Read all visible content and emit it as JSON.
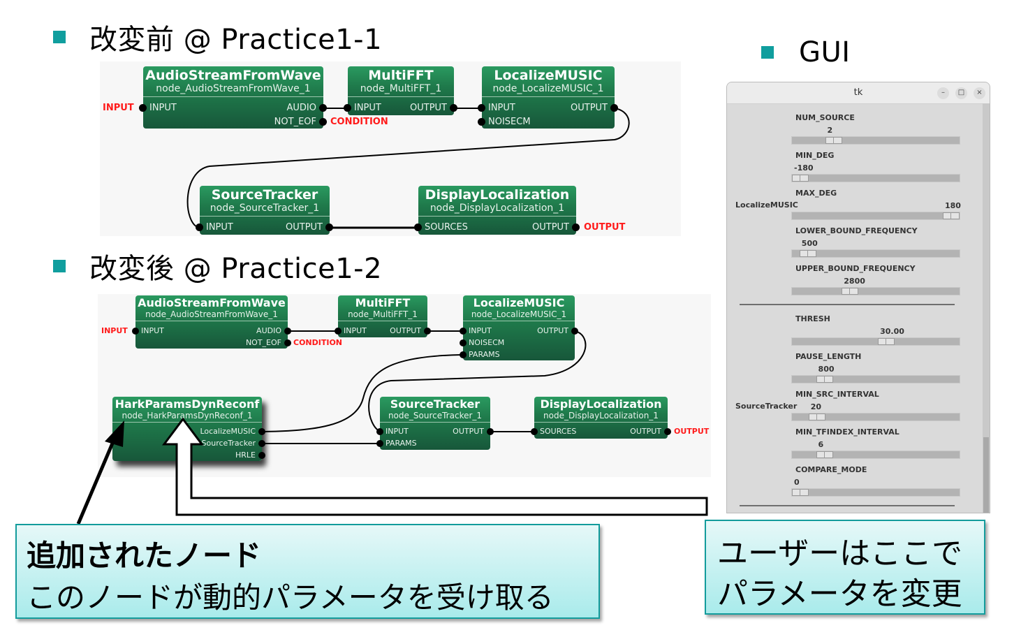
{
  "headings": {
    "before": "改変前 @ Practice1-1",
    "after": "改変後 @ Practice1-2",
    "gui": "GUI"
  },
  "colors": {
    "bullet": "#109e9e",
    "node_green": "#1f7a4b",
    "external_label": "#ff1a1a",
    "callout_border": "#139c9c"
  },
  "before_network": {
    "input_label": "INPUT",
    "condition_label": "CONDITION",
    "output_label": "OUTPUT",
    "nodes": [
      {
        "title": "AudioStreamFromWave",
        "id": "node_AudioStreamFromWave_1",
        "inputs": [
          "INPUT"
        ],
        "outputs": [
          "AUDIO",
          "NOT_EOF"
        ]
      },
      {
        "title": "MultiFFT",
        "id": "node_MultiFFT_1",
        "inputs": [
          "INPUT"
        ],
        "outputs": [
          "OUTPUT"
        ]
      },
      {
        "title": "LocalizeMUSIC",
        "id": "node_LocalizeMUSIC_1",
        "inputs": [
          "INPUT",
          "NOISECM"
        ],
        "outputs": [
          "OUTPUT"
        ]
      },
      {
        "title": "SourceTracker",
        "id": "node_SourceTracker_1",
        "inputs": [
          "INPUT"
        ],
        "outputs": [
          "OUTPUT"
        ]
      },
      {
        "title": "DisplayLocalization",
        "id": "node_DisplayLocalization_1",
        "inputs": [
          "SOURCES"
        ],
        "outputs": [
          "OUTPUT"
        ]
      }
    ]
  },
  "after_network": {
    "input_label": "INPUT",
    "condition_label": "CONDITION",
    "output_label": "OUTPUT",
    "nodes": [
      {
        "title": "AudioStreamFromWave",
        "id": "node_AudioStreamFromWave_1",
        "inputs": [
          "INPUT"
        ],
        "outputs": [
          "AUDIO",
          "NOT_EOF"
        ]
      },
      {
        "title": "MultiFFT",
        "id": "node_MultiFFT_1",
        "inputs": [
          "INPUT"
        ],
        "outputs": [
          "OUTPUT"
        ]
      },
      {
        "title": "LocalizeMUSIC",
        "id": "node_LocalizeMUSIC_1",
        "inputs": [
          "INPUT",
          "NOISECM",
          "PARAMS"
        ],
        "outputs": [
          "OUTPUT"
        ]
      },
      {
        "title": "HarkParamsDynReconf",
        "id": "node_HarkParamsDynReconf_1",
        "inputs": [],
        "outputs": [
          "LocalizeMUSIC",
          "SourceTracker",
          "HRLE"
        ]
      },
      {
        "title": "SourceTracker",
        "id": "node_SourceTracker_1",
        "inputs": [
          "INPUT",
          "PARAMS"
        ],
        "outputs": [
          "OUTPUT"
        ]
      },
      {
        "title": "DisplayLocalization",
        "id": "node_DisplayLocalization_1",
        "inputs": [
          "SOURCES"
        ],
        "outputs": [
          "OUTPUT"
        ]
      }
    ]
  },
  "tk_window": {
    "title": "tk",
    "buttons": {
      "minimize": "–",
      "maximize": "□",
      "close": "×"
    },
    "groups": [
      {
        "name": "LocalizeMUSIC",
        "params": [
          {
            "label": "NUM_SOURCE",
            "value": "2",
            "fraction": 0.22
          },
          {
            "label": "MIN_DEG",
            "value": "-180",
            "fraction": 0.0
          },
          {
            "label": "MAX_DEG",
            "value": "180",
            "fraction": 1.0
          },
          {
            "label": "LOWER_BOUND_FREQUENCY",
            "value": "500",
            "fraction": 0.05
          },
          {
            "label": "UPPER_BOUND_FREQUENCY",
            "value": "2800",
            "fraction": 0.33
          }
        ]
      },
      {
        "name": "SourceTracker",
        "params": [
          {
            "label": "THRESH",
            "value": "30.00",
            "fraction": 0.57
          },
          {
            "label": "PAUSE_LENGTH",
            "value": "800",
            "fraction": 0.16
          },
          {
            "label": "MIN_SRC_INTERVAL",
            "value": "20",
            "fraction": 0.11
          },
          {
            "label": "MIN_TFINDEX_INTERVAL",
            "value": "6",
            "fraction": 0.16
          },
          {
            "label": "COMPARE_MODE",
            "value": "0",
            "fraction": 0.0
          }
        ]
      }
    ]
  },
  "callouts": {
    "added_node": {
      "line1": "追加されたノード",
      "line2": "このノードが動的パラメータを受け取る"
    },
    "user_change": {
      "line1": "ユーザーはここで",
      "line2": "パラメータを変更"
    }
  }
}
